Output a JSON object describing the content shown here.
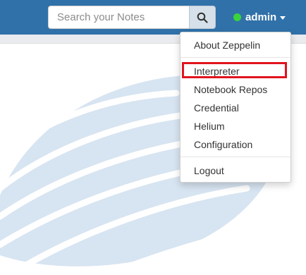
{
  "search": {
    "placeholder": "Search your Notes",
    "button_icon": "search-icon"
  },
  "user": {
    "name": "admin",
    "status_color": "#3bd33b",
    "caret_icon": "caret-down-icon"
  },
  "menu": {
    "items": [
      {
        "label": "About Zeppelin"
      },
      {
        "label": "Interpreter",
        "highlighted": true
      },
      {
        "label": "Notebook Repos"
      },
      {
        "label": "Credential"
      },
      {
        "label": "Helium"
      },
      {
        "label": "Configuration"
      },
      {
        "label": "Logout"
      }
    ]
  },
  "colors": {
    "navbar": "#3071a9",
    "highlight": "#e0141e",
    "background_logo": "#d7e4f1"
  }
}
